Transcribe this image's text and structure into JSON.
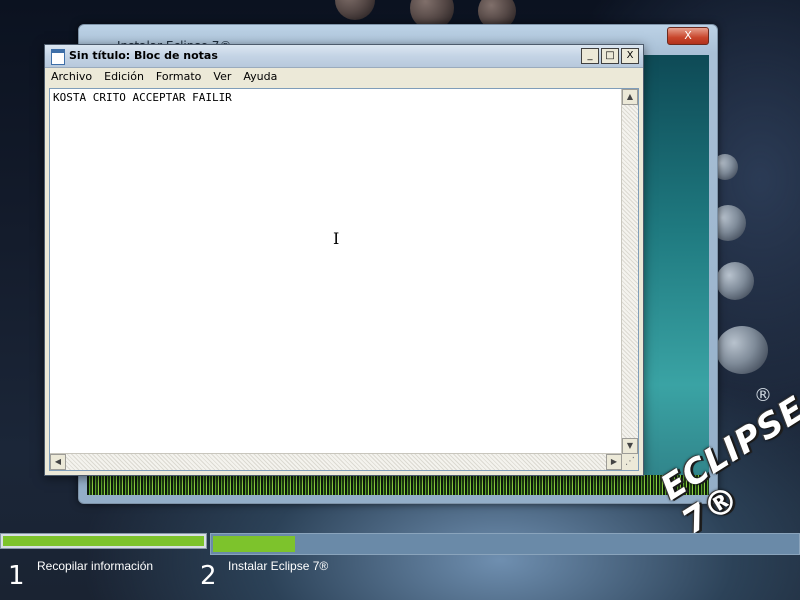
{
  "installer": {
    "title": "Instalar Eclipse 7®",
    "close_label": "X"
  },
  "notepad": {
    "title": "Sin título: Bloc de notas",
    "controls": {
      "minimize": "_",
      "maximize": "□",
      "close": "X"
    },
    "menu": [
      "Archivo",
      "Edición",
      "Formato",
      "Ver",
      "Ayuda"
    ],
    "content": "KOSTA CRITO ACCEPTAR FAILIR",
    "cursor": "I"
  },
  "logo": {
    "text": "ECLIPSE 7®",
    "registered": "®"
  },
  "progress": {
    "steps": [
      {
        "number": "1",
        "label": "Recopilar información",
        "fraction": 1.0
      },
      {
        "number": "2",
        "label": "Instalar Eclipse 7®",
        "fraction": 0.14
      }
    ]
  },
  "colors": {
    "progress_fill": "#7dc32c",
    "notepad_chrome": "#ece9d8",
    "desktop": "#141c2c"
  }
}
